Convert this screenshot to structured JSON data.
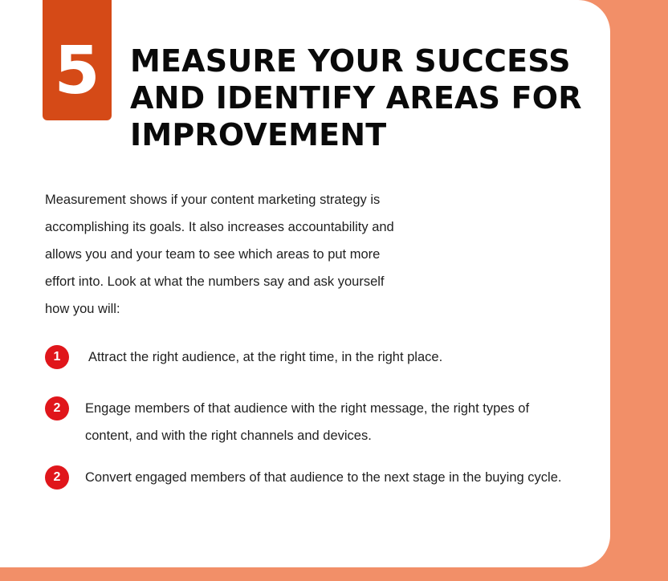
{
  "step": {
    "number": "5"
  },
  "title": {
    "lines": [
      "MEASURE YOUR SUCCESS",
      "AND IDENTIFY AREAS FOR",
      "IMPROVEMENT"
    ]
  },
  "intro": {
    "lines": [
      "Measurement shows if your content marketing strategy is",
      "accomplishing its goals. It also increases accountability and",
      "allows you and your team to see which areas to put more",
      "effort into. Look at what the numbers say and ask yourself",
      "how you will:"
    ]
  },
  "list": [
    {
      "number": "1",
      "lines": [
        "Attract the right audience, at the right time, in the right place."
      ]
    },
    {
      "number": "2",
      "lines": [
        "Engage members of that audience with the right message, the right types of",
        "content, and with the right channels and devices."
      ]
    },
    {
      "number": "2",
      "lines": [
        "Convert engaged members of that audience to the next stage in the buying cycle."
      ]
    }
  ],
  "colors": {
    "background": "#f28f68",
    "card": "#ffffff",
    "badge": "#d54a17",
    "bullet": "#e0161b",
    "title": "#0a0a0a",
    "text": "#1f1f1f"
  }
}
